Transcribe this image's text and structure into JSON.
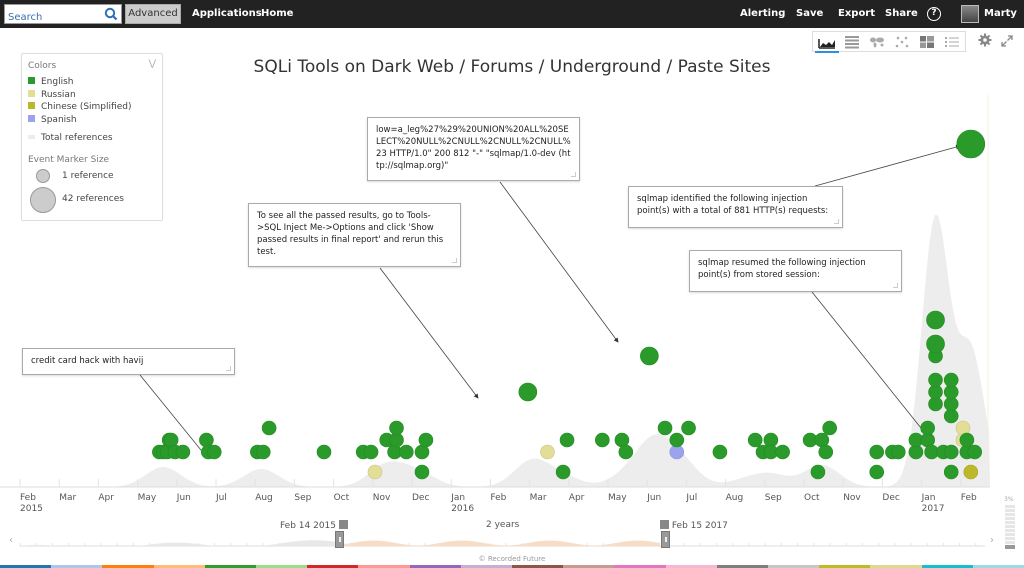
{
  "topbar": {
    "search_placeholder": "Search",
    "advanced_label": "Advanced",
    "left_links": [
      {
        "label": "Applications"
      },
      {
        "label": "Home"
      }
    ],
    "right_links": [
      {
        "label": "Alerting"
      },
      {
        "label": "Save"
      },
      {
        "label": "Export"
      },
      {
        "label": "Share"
      }
    ],
    "help_label": "?",
    "user_name": "Marty"
  },
  "viz_toolbar": {
    "tabs": [
      {
        "icon": "timeline-icon",
        "active": true
      },
      {
        "icon": "table-icon",
        "active": false
      },
      {
        "icon": "map-icon",
        "active": false
      },
      {
        "icon": "network-icon",
        "active": false
      },
      {
        "icon": "heatmap-icon",
        "active": false
      },
      {
        "icon": "list-icon",
        "active": false
      }
    ]
  },
  "legend": {
    "colors_header": "Colors",
    "collapse_icon": "double-chevron-down-icon",
    "languages": [
      {
        "label": "English",
        "color": "#2a9b2a"
      },
      {
        "label": "Russian",
        "color": "#e3de96"
      },
      {
        "label": "Chinese (Simplified)",
        "color": "#bdb82a"
      },
      {
        "label": "Spanish",
        "color": "#9ca3ee"
      }
    ],
    "total_refs_label": "Total references",
    "total_refs_color": "#ececec",
    "marker_size_header": "Event Marker Size",
    "marker_sizes": [
      {
        "label": "1 reference"
      },
      {
        "label": "42 references"
      }
    ]
  },
  "chart_title": "SQLi Tools on Dark Web / Forums / Underground / Paste Sites",
  "callouts": [
    {
      "text": "credit card hack with havij"
    },
    {
      "text": "To see all the passed results, go to Tools->SQL Inject Me->Options and click 'Show passed results in final report' and rerun this test."
    },
    {
      "text": "low=a_leg%27%29%20UNION%20ALL%20SELECT%20NULL%2CNULL%2CNULL%2CNULL%23 HTTP/1.0\" 200 812 \"-\" \"sqlmap/1.0-dev (http://sqlmap.org)\""
    },
    {
      "text": "sqlmap identified the following injection point(s) with a total of 881 HTTP(s) requests:"
    },
    {
      "text": "sqlmap resumed the following injection point(s) from stored session:"
    }
  ],
  "chart_data": {
    "type": "scatter",
    "title": "SQLi Tools on Dark Web / Forums / Underground / Paste Sites",
    "xlabel": "",
    "ylabel": "",
    "x_range": [
      "2015-02-14",
      "2017-02-15"
    ],
    "x_ticks": [
      {
        "label": "Feb",
        "sub": "2015"
      },
      {
        "label": "Mar"
      },
      {
        "label": "Apr"
      },
      {
        "label": "May"
      },
      {
        "label": "Jun"
      },
      {
        "label": "Jul"
      },
      {
        "label": "Aug"
      },
      {
        "label": "Sep"
      },
      {
        "label": "Oct"
      },
      {
        "label": "Nov"
      },
      {
        "label": "Dec"
      },
      {
        "label": "Jan",
        "sub": "2016"
      },
      {
        "label": "Feb"
      },
      {
        "label": "Mar"
      },
      {
        "label": "Apr"
      },
      {
        "label": "May"
      },
      {
        "label": "Jun"
      },
      {
        "label": "Jul"
      },
      {
        "label": "Aug"
      },
      {
        "label": "Sep"
      },
      {
        "label": "Oct"
      },
      {
        "label": "Nov"
      },
      {
        "label": "Dec"
      },
      {
        "label": "Jan",
        "sub": "2017"
      },
      {
        "label": "Feb"
      }
    ],
    "legend_position": "top-left",
    "series": [
      {
        "name": "English",
        "color": "#2a9b2a"
      },
      {
        "name": "Russian",
        "color": "#e3de96"
      },
      {
        "name": "Chinese (Simplified)",
        "color": "#bdb82a"
      },
      {
        "name": "Spanish",
        "color": "#9ca3ee"
      }
    ],
    "events": [
      {
        "month": 3.3,
        "level": 1,
        "lang": "English",
        "refs": 1
      },
      {
        "month": 3.4,
        "level": 1,
        "lang": "English",
        "refs": 1
      },
      {
        "month": 3.5,
        "level": 1,
        "lang": "English",
        "refs": 1
      },
      {
        "month": 3.55,
        "level": 2,
        "lang": "English",
        "refs": 1
      },
      {
        "month": 3.6,
        "level": 2,
        "lang": "English",
        "refs": 1
      },
      {
        "month": 3.7,
        "level": 1,
        "lang": "English",
        "refs": 1
      },
      {
        "month": 3.9,
        "level": 1,
        "lang": "English",
        "refs": 1
      },
      {
        "month": 4.5,
        "level": 2,
        "lang": "English",
        "refs": 1
      },
      {
        "month": 4.55,
        "level": 1,
        "lang": "English",
        "refs": 1
      },
      {
        "month": 4.7,
        "level": 1,
        "lang": "English",
        "refs": 1
      },
      {
        "month": 5.8,
        "level": 1,
        "lang": "English",
        "refs": 1
      },
      {
        "month": 5.95,
        "level": 1,
        "lang": "English",
        "refs": 1
      },
      {
        "month": 6.1,
        "level": 3,
        "lang": "English",
        "refs": 1
      },
      {
        "month": 7.5,
        "level": 1,
        "lang": "English",
        "refs": 1
      },
      {
        "month": 8.5,
        "level": 1,
        "lang": "English",
        "refs": 1
      },
      {
        "month": 8.7,
        "level": 1,
        "lang": "English",
        "refs": 1
      },
      {
        "month": 8.8,
        "level": 0,
        "lang": "Russian",
        "refs": 1
      },
      {
        "month": 9.1,
        "level": 2,
        "lang": "English",
        "refs": 1
      },
      {
        "month": 9.3,
        "level": 1,
        "lang": "English",
        "refs": 1
      },
      {
        "month": 9.35,
        "level": 2,
        "lang": "English",
        "refs": 1
      },
      {
        "month": 9.35,
        "level": 3,
        "lang": "English",
        "refs": 1
      },
      {
        "month": 9.6,
        "level": 1,
        "lang": "English",
        "refs": 1
      },
      {
        "month": 10.0,
        "level": 0,
        "lang": "English",
        "refs": 1
      },
      {
        "month": 10.0,
        "level": 1,
        "lang": "English",
        "refs": 1
      },
      {
        "month": 10.1,
        "level": 2,
        "lang": "English",
        "refs": 1
      },
      {
        "month": 12.7,
        "level": 6,
        "lang": "English",
        "refs": 2
      },
      {
        "month": 13.2,
        "level": 1,
        "lang": "Russian",
        "refs": 1
      },
      {
        "month": 13.6,
        "level": 0,
        "lang": "English",
        "refs": 1
      },
      {
        "month": 13.7,
        "level": 2,
        "lang": "English",
        "refs": 1
      },
      {
        "month": 14.6,
        "level": 2,
        "lang": "English",
        "refs": 1
      },
      {
        "month": 15.1,
        "level": 2,
        "lang": "English",
        "refs": 1
      },
      {
        "month": 15.2,
        "level": 1,
        "lang": "English",
        "refs": 1
      },
      {
        "month": 15.8,
        "level": 9,
        "lang": "English",
        "refs": 2
      },
      {
        "month": 16.2,
        "level": 3,
        "lang": "English",
        "refs": 1
      },
      {
        "month": 16.5,
        "level": 1,
        "lang": "Spanish",
        "refs": 1
      },
      {
        "month": 16.5,
        "level": 2,
        "lang": "English",
        "refs": 1
      },
      {
        "month": 16.8,
        "level": 3,
        "lang": "English",
        "refs": 1
      },
      {
        "month": 17.6,
        "level": 1,
        "lang": "English",
        "refs": 1
      },
      {
        "month": 18.5,
        "level": 2,
        "lang": "English",
        "refs": 1
      },
      {
        "month": 18.7,
        "level": 1,
        "lang": "English",
        "refs": 1
      },
      {
        "month": 18.9,
        "level": 2,
        "lang": "English",
        "refs": 1
      },
      {
        "month": 18.9,
        "level": 1,
        "lang": "English",
        "refs": 1
      },
      {
        "month": 19.2,
        "level": 1,
        "lang": "English",
        "refs": 1
      },
      {
        "month": 19.9,
        "level": 2,
        "lang": "English",
        "refs": 1
      },
      {
        "month": 20.1,
        "level": 0,
        "lang": "English",
        "refs": 1
      },
      {
        "month": 20.2,
        "level": 2,
        "lang": "English",
        "refs": 1
      },
      {
        "month": 20.3,
        "level": 1,
        "lang": "English",
        "refs": 1
      },
      {
        "month": 20.4,
        "level": 3,
        "lang": "English",
        "refs": 1
      },
      {
        "month": 21.6,
        "level": 0,
        "lang": "English",
        "refs": 1
      },
      {
        "month": 21.6,
        "level": 1,
        "lang": "English",
        "refs": 1
      },
      {
        "month": 22.0,
        "level": 1,
        "lang": "English",
        "refs": 1
      },
      {
        "month": 22.15,
        "level": 1,
        "lang": "English",
        "refs": 1
      },
      {
        "month": 22.6,
        "level": 1,
        "lang": "English",
        "refs": 1
      },
      {
        "month": 22.6,
        "level": 2,
        "lang": "English",
        "refs": 1
      },
      {
        "month": 22.9,
        "level": 2,
        "lang": "English",
        "refs": 1
      },
      {
        "month": 22.9,
        "level": 3,
        "lang": "English",
        "refs": 1
      },
      {
        "month": 23.0,
        "level": 1,
        "lang": "English",
        "refs": 1
      },
      {
        "month": 23.1,
        "level": 5,
        "lang": "English",
        "refs": 1
      },
      {
        "month": 23.1,
        "level": 6,
        "lang": "English",
        "refs": 1
      },
      {
        "month": 23.1,
        "level": 7,
        "lang": "English",
        "refs": 1
      },
      {
        "month": 23.1,
        "level": 9,
        "lang": "English",
        "refs": 1
      },
      {
        "month": 23.1,
        "level": 10,
        "lang": "English",
        "refs": 2
      },
      {
        "month": 23.1,
        "level": 12,
        "lang": "English",
        "refs": 2
      },
      {
        "month": 23.3,
        "level": 1,
        "lang": "English",
        "refs": 1
      },
      {
        "month": 23.5,
        "level": 1,
        "lang": "English",
        "refs": 1
      },
      {
        "month": 23.5,
        "level": 0,
        "lang": "English",
        "refs": 1
      },
      {
        "month": 23.5,
        "level": 4,
        "lang": "English",
        "refs": 1
      },
      {
        "month": 23.5,
        "level": 5,
        "lang": "English",
        "refs": 1
      },
      {
        "month": 23.5,
        "level": 6,
        "lang": "English",
        "refs": 1
      },
      {
        "month": 23.5,
        "level": 7,
        "lang": "English",
        "refs": 1
      },
      {
        "month": 23.8,
        "level": 2,
        "lang": "Russian",
        "refs": 1
      },
      {
        "month": 23.8,
        "level": 3,
        "lang": "Russian",
        "refs": 1
      },
      {
        "month": 23.9,
        "level": 1,
        "lang": "English",
        "refs": 1
      },
      {
        "month": 23.9,
        "level": 2,
        "lang": "English",
        "refs": 1
      },
      {
        "month": 24.0,
        "level": 0,
        "lang": "Chinese (Simplified)",
        "refs": 1
      },
      {
        "month": 24.1,
        "level": 1,
        "lang": "English",
        "refs": 1
      },
      {
        "month": 24.0,
        "level": 13,
        "lang": "English",
        "refs": 42
      }
    ]
  },
  "range_selector": {
    "start_label": "Feb 14 2015",
    "duration_label": "2 years",
    "end_label": "Feb 15 2017",
    "prev_icon": "chevron-left-icon",
    "next_icon": "chevron-right-icon"
  },
  "zoom_indicator": {
    "percent_label": "3%",
    "value": 0.03
  },
  "credit": "© Recorded Future",
  "color_strip": [
    "#1f77b4",
    "#aec7e8",
    "#ff7f0e",
    "#ffbb78",
    "#2ca02c",
    "#98df8a",
    "#d62728",
    "#ff9896",
    "#9467bd",
    "#c5b0d5",
    "#8c564b",
    "#c49c94",
    "#e377c2",
    "#f7b6d2",
    "#7f7f7f",
    "#c7c7c7",
    "#bcbd22",
    "#dbdb8d",
    "#17becf",
    "#9edae5"
  ]
}
